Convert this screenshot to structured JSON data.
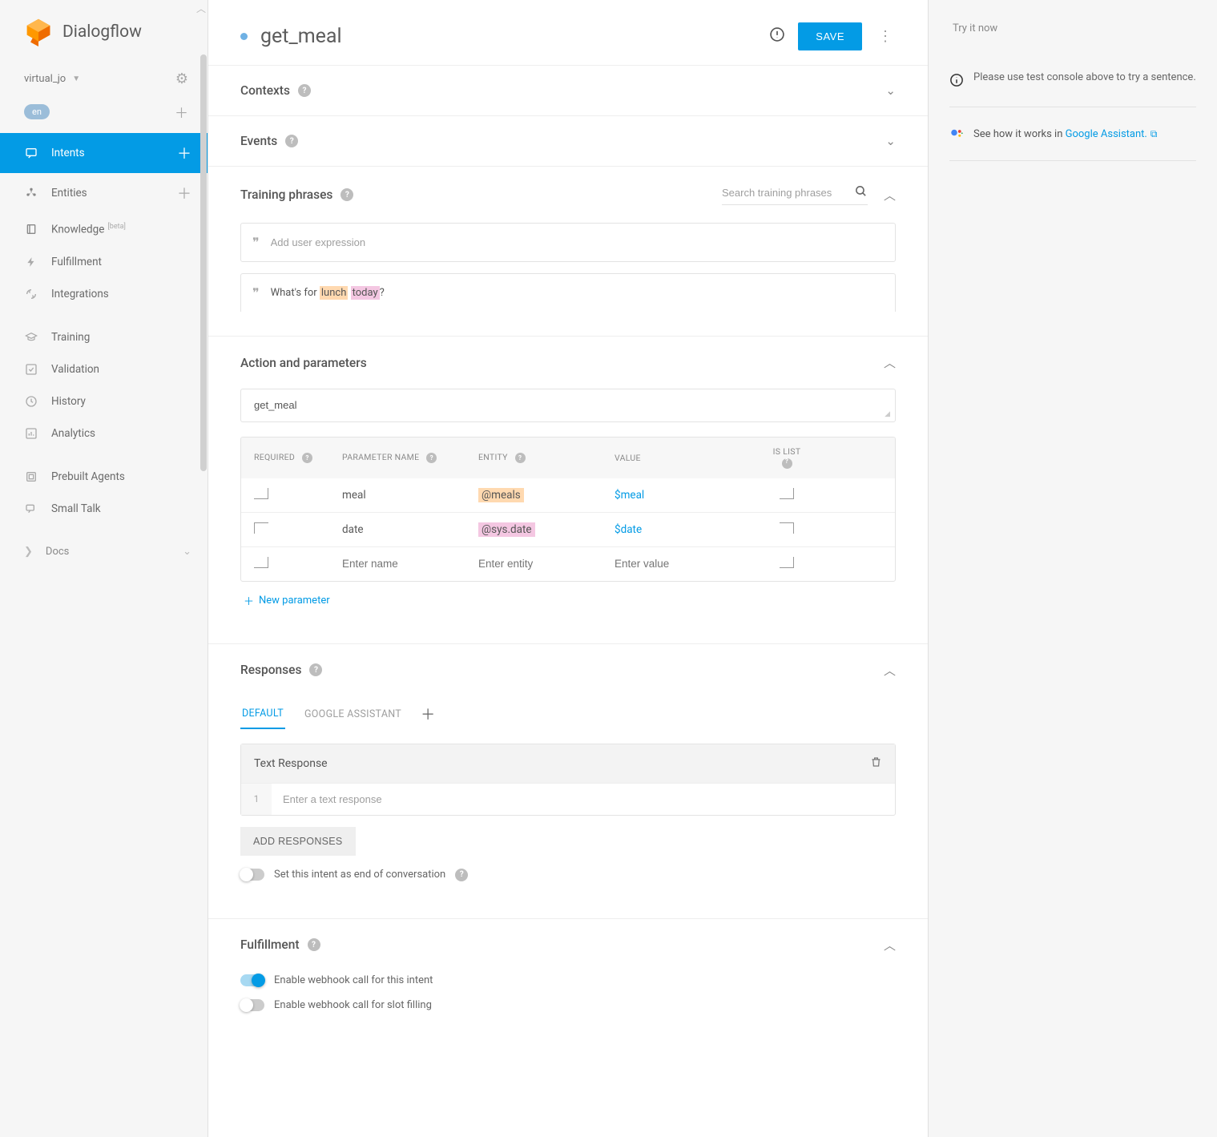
{
  "brand": "Dialogflow",
  "agent": {
    "name": "virtual_jo",
    "lang": "en"
  },
  "nav": {
    "intents": "Intents",
    "entities": "Entities",
    "knowledge": "Knowledge",
    "knowledge_badge": "[beta]",
    "fulfillment": "Fulfillment",
    "integrations": "Integrations",
    "training": "Training",
    "validation": "Validation",
    "history": "History",
    "analytics": "Analytics",
    "prebuilt": "Prebuilt Agents",
    "smalltalk": "Small Talk",
    "docs": "Docs"
  },
  "header": {
    "title": "get_meal",
    "save": "SAVE"
  },
  "sections": {
    "contexts": "Contexts",
    "events": "Events",
    "training": "Training phrases",
    "training_search_placeholder": "Search training phrases",
    "add_expression_placeholder": "Add user expression",
    "phrase_prefix": "What's for ",
    "phrase_hl1": "lunch",
    "phrase_sep": " ",
    "phrase_hl2": "today",
    "phrase_suffix": "?",
    "action": "Action and parameters",
    "action_value": "get_meal",
    "responses": "Responses",
    "fulfillment": "Fulfillment"
  },
  "param_table": {
    "head": {
      "required": "REQUIRED",
      "name": "PARAMETER NAME",
      "entity": "ENTITY",
      "value": "VALUE",
      "islist": "IS LIST"
    },
    "rows": [
      {
        "name": "meal",
        "entity": "@meals",
        "entity_style": "orange",
        "value": "$meal"
      },
      {
        "name": "date",
        "entity": "@sys.date",
        "entity_style": "pink",
        "value": "$date"
      }
    ],
    "placeholder": {
      "name": "Enter name",
      "entity": "Enter entity",
      "value": "Enter value"
    },
    "new_param": "New parameter"
  },
  "responses": {
    "tabs": {
      "default": "DEFAULT",
      "ga": "GOOGLE ASSISTANT"
    },
    "card_title": "Text Response",
    "row_num": "1",
    "row_placeholder": "Enter a text response",
    "add_btn": "ADD RESPONSES",
    "end_conv": "Set this intent as end of conversation"
  },
  "fulfillment": {
    "webhook_intent": "Enable webhook call for this intent",
    "webhook_slot": "Enable webhook call for slot filling"
  },
  "right": {
    "try": "Try it now",
    "info": "Please use test console above to try a sentence.",
    "ga_prefix": "See how it works in ",
    "ga_link": "Google Assistant."
  }
}
